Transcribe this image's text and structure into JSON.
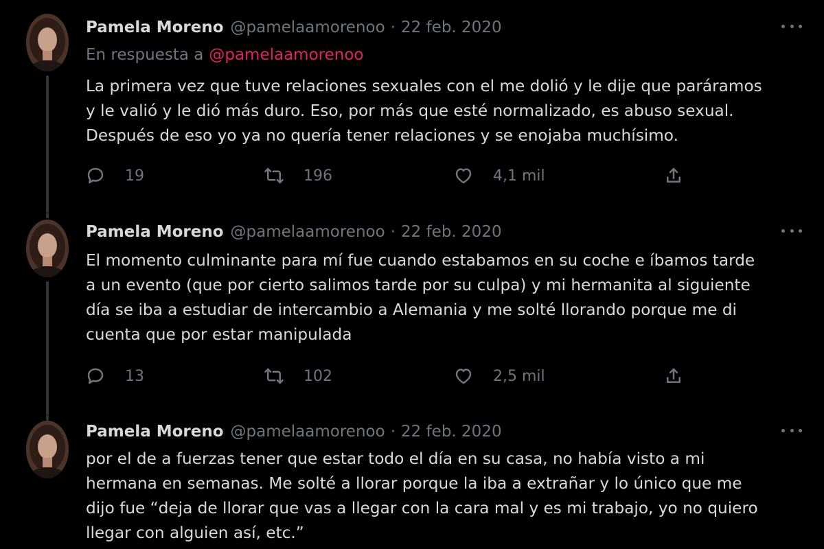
{
  "tweets": [
    {
      "author_name": "Pamela Moreno",
      "handle": "@pamelaamorenoo",
      "separator": "·",
      "date": "22 feb. 2020",
      "reply_to_label": "En respuesta a",
      "reply_to_handle": "@pamelaamorenoo",
      "text_lines": [
        "La primera vez que tuve relaciones sexuales con el me dolió y le dije que paráramos",
        "y le valió y le dió más duro. Eso, por más que esté normalizado, es abuso sexual.",
        "Después de eso yo ya no quería tener relaciones y se enojaba muchísimo."
      ],
      "replies": "19",
      "retweets": "196",
      "likes": "4,1 mil"
    },
    {
      "author_name": "Pamela Moreno",
      "handle": "@pamelaamorenoo",
      "separator": "·",
      "date": "22 feb. 2020",
      "text_lines": [
        "El momento culminante para mí fue cuando estabamos en su coche e íbamos tarde",
        "a un evento (que por cierto salimos tarde por su culpa) y mi hermanita al siguiente",
        "día se iba a estudiar de intercambio a Alemania y me solté llorando porque me di",
        "cuenta que por estar manipulada"
      ],
      "replies": "13",
      "retweets": "102",
      "likes": "2,5 mil"
    },
    {
      "author_name": "Pamela Moreno",
      "handle": "@pamelaamorenoo",
      "separator": "·",
      "date": "22 feb. 2020",
      "text_lines": [
        "por el de a fuerzas tener que estar todo el día en su casa, no había visto a mi",
        "hermana en semanas. Me solté a llorar porque la iba a extrañar y lo único que me",
        "dijo fue “deja de llorar que vas a llegar con la cara mal y es mi trabajo, yo no quiero",
        "llegar con alguien así, etc.”"
      ]
    }
  ],
  "icons": {
    "reply": "reply-icon",
    "retweet": "retweet-icon",
    "like": "heart-icon",
    "share": "share-icon",
    "more": "more-icon"
  },
  "colors": {
    "background": "#000000",
    "text": "#d9d9d9",
    "secondary": "#6e767d",
    "mention": "#e0245e",
    "thread_line": "#333639"
  }
}
